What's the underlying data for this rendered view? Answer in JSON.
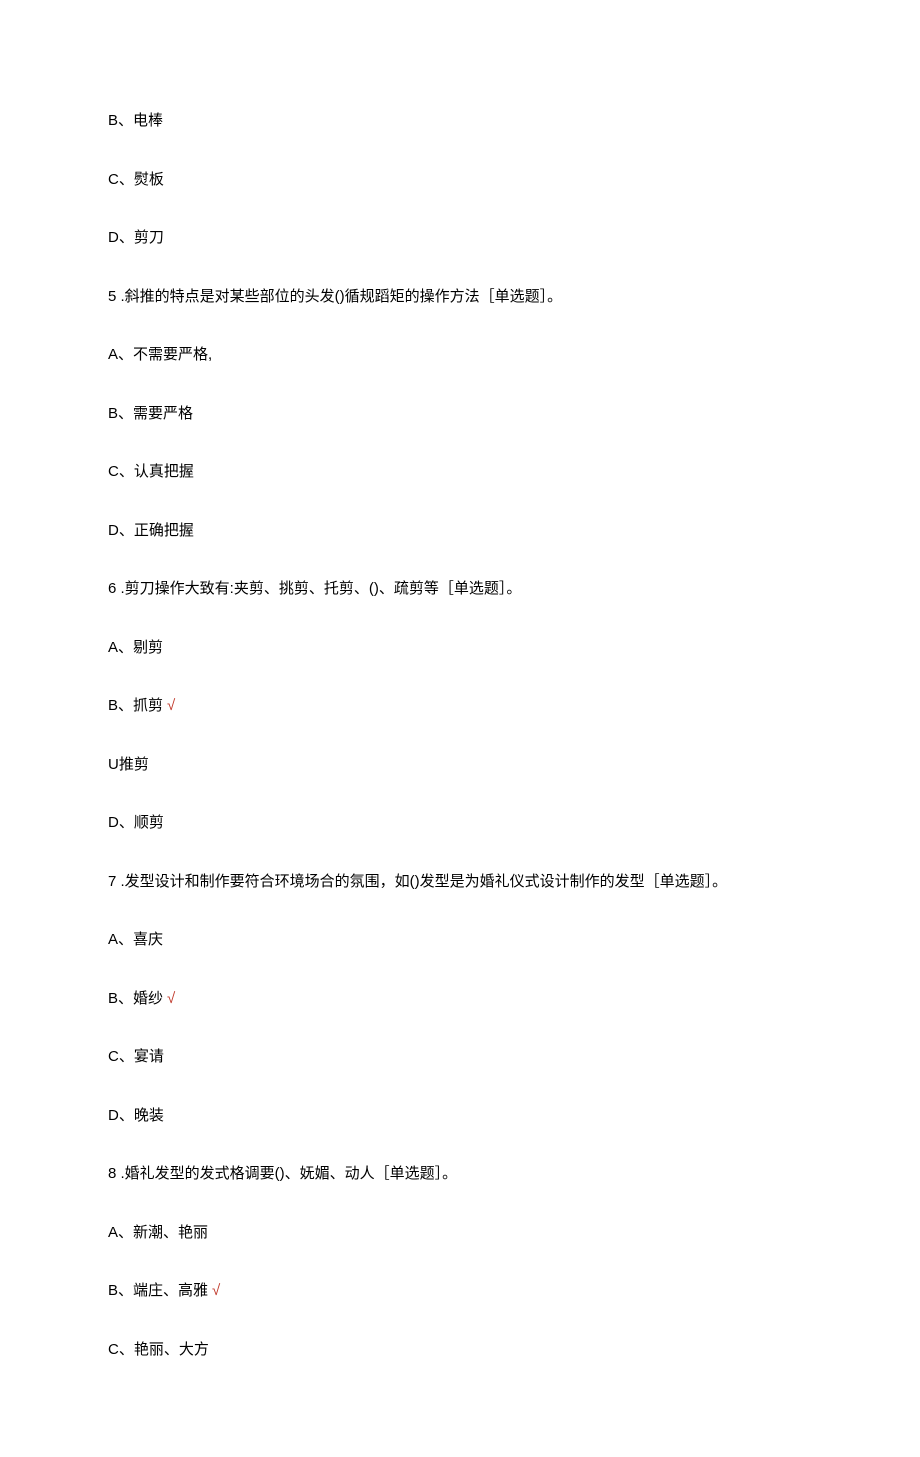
{
  "lines": [
    {
      "text": "B、电棒",
      "correct": false
    },
    {
      "text": "C、熨板",
      "correct": false
    },
    {
      "text": "D、剪刀",
      "correct": false
    },
    {
      "text": "5   .斜推的特点是对某些部位的头发()循规蹈矩的操作方法［单选题］。",
      "correct": false
    },
    {
      "text": "A、不需要严格,",
      "correct": false
    },
    {
      "text": "B、需要严格",
      "correct": false
    },
    {
      "text": "C、认真把握",
      "correct": false
    },
    {
      "text": "D、正确把握",
      "correct": false
    },
    {
      "text": "6   .剪刀操作大致有:夹剪、挑剪、托剪、()、疏剪等［单选题］。",
      "correct": false
    },
    {
      "text": "A、剔剪",
      "correct": false
    },
    {
      "text": "B、抓剪",
      "correct": true
    },
    {
      "text": "U推剪",
      "correct": false
    },
    {
      "text": "D、顺剪",
      "correct": false
    },
    {
      "text": "7   .发型设计和制作要符合环境场合的氛围，如()发型是为婚礼仪式设计制作的发型［单选题］。",
      "correct": false
    },
    {
      "text": "A、喜庆",
      "correct": false
    },
    {
      "text": "B、婚纱",
      "correct": true
    },
    {
      "text": "C、宴请",
      "correct": false
    },
    {
      "text": "D、晚装",
      "correct": false
    },
    {
      "text": "8   .婚礼发型的发式格调要()、妩媚、动人［单选题］。",
      "correct": false
    },
    {
      "text": "A、新潮、艳丽",
      "correct": false
    },
    {
      "text": "B、端庄、高雅",
      "correct": true
    },
    {
      "text": "C、艳丽、大方",
      "correct": false
    }
  ],
  "checkmark": "√"
}
